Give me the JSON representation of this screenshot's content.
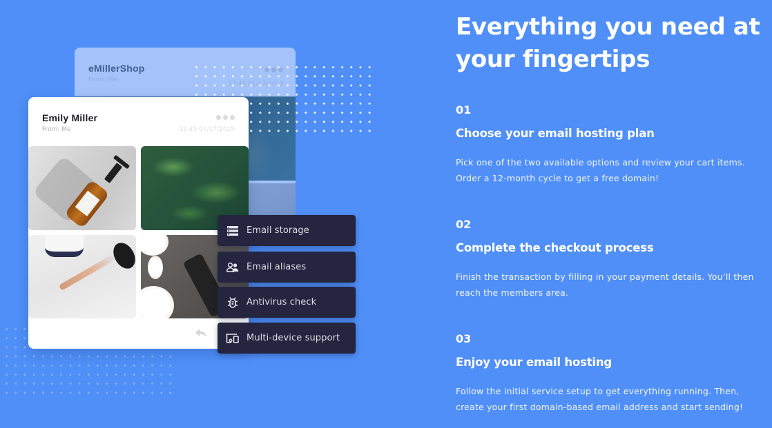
{
  "colors": {
    "background": "#4f8ff7",
    "feature_pill": "#252540",
    "back_card": "#a3c3fa",
    "front_card": "#ffffff"
  },
  "mockup": {
    "back_email": {
      "sender": "eMillerShop",
      "from": "From: Me",
      "timestamp": "12:45 01/17/2019",
      "menu_icon": "more-horizontal-icon"
    },
    "front_email": {
      "sender": "Emily Miller",
      "from": "From: Me",
      "timestamp": "12:45 01/17/2019",
      "menu_icon": "more-horizontal-icon",
      "images": [
        {
          "subject": "amber pump bottle"
        },
        {
          "subject": "green leaves"
        },
        {
          "subject": "glass dropper on marble"
        },
        {
          "subject": "cotton and dark vial"
        }
      ],
      "reply_icon": "reply-icon"
    },
    "features": [
      {
        "label": "Email storage",
        "icon": "storage-icon"
      },
      {
        "label": "Email aliases",
        "icon": "users-icon"
      },
      {
        "label": "Antivirus check",
        "icon": "bug-icon"
      },
      {
        "label": "Multi-device support",
        "icon": "devices-icon"
      }
    ]
  },
  "content": {
    "title": "Everything you need at your fingertips",
    "steps": [
      {
        "number": "01",
        "heading": "Choose your email hosting plan",
        "body": "Pick one of the two available options and review your cart items. Order a 12-month cycle to get a free domain!"
      },
      {
        "number": "02",
        "heading": "Complete the checkout process",
        "body": "Finish the transaction by filling in your payment details. You’ll then reach the members area."
      },
      {
        "number": "03",
        "heading": "Enjoy your email hosting",
        "body": "Follow the initial service setup to get everything running. Then, create your first domain-based email address and start sending!"
      }
    ]
  }
}
